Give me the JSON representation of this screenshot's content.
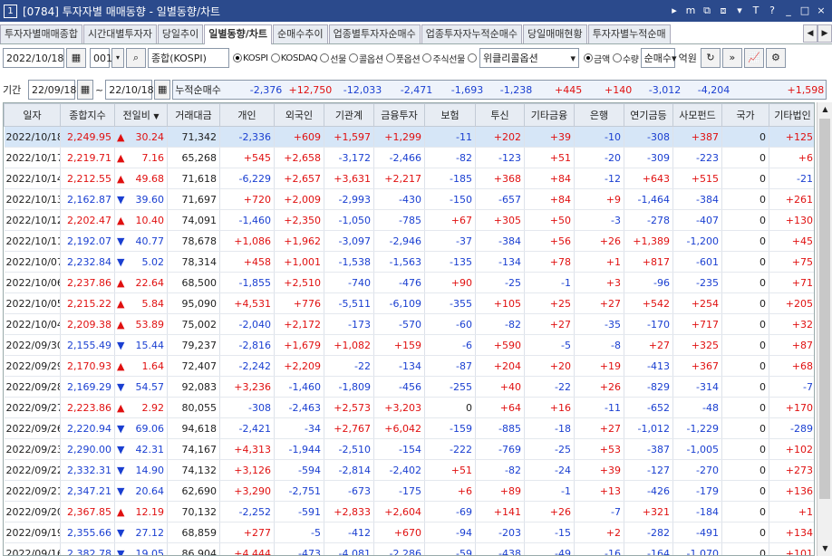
{
  "window": {
    "number": "1",
    "title": "[0784] 투자자별 매매동향 - 일별동향/차트",
    "controls": [
      "▸",
      "m",
      "⧉",
      "⧈",
      "▾",
      "T",
      "?",
      "_",
      "□",
      "×"
    ]
  },
  "tabs": [
    "투자자별매매종합",
    "시간대별투자자",
    "당일추이",
    "일별동향/차트",
    "순매수추이",
    "업종별투자자순매수",
    "업종투자자누적순매수",
    "당일매매현황",
    "투자자별누적순매"
  ],
  "active_tab": 3,
  "toolbar": {
    "date": "2022/10/18",
    "market_code": "001",
    "market_name": "종합(KOSPI)",
    "markets": [
      {
        "label": "KOSPI",
        "on": true
      },
      {
        "label": "KOSDAQ",
        "on": false
      },
      {
        "label": "선물",
        "on": false
      },
      {
        "label": "콜옵션",
        "on": false
      },
      {
        "label": "풋옵션",
        "on": false
      },
      {
        "label": "주식선물",
        "on": false
      },
      {
        "label": "",
        "on": false
      }
    ],
    "weekly_option": "위클리콜옵션",
    "unit_options": [
      {
        "label": "금액",
        "on": true
      },
      {
        "label": "수량",
        "on": false
      }
    ],
    "trade_type": "순매수",
    "unit": "억원"
  },
  "period": {
    "label": "기간",
    "from": "22/09/18",
    "to": "22/10/18",
    "cum_label": "누적순매수",
    "cum_values": [
      {
        "v": "-2,376",
        "c": "blue"
      },
      {
        "v": "+12,750",
        "c": "red"
      },
      {
        "v": "-12,033",
        "c": "blue"
      },
      {
        "v": "-2,471",
        "c": "blue"
      },
      {
        "v": "-1,693",
        "c": "blue"
      },
      {
        "v": "-1,238",
        "c": "blue"
      },
      {
        "v": "+445",
        "c": "red"
      },
      {
        "v": "+140",
        "c": "red"
      },
      {
        "v": "-3,012",
        "c": "blue"
      },
      {
        "v": "-4,204",
        "c": "blue"
      },
      {
        "v": "",
        "c": "black"
      },
      {
        "v": "+1,598",
        "c": "red"
      }
    ]
  },
  "columns": [
    "일자",
    "종합지수",
    "전일비",
    "거래대금",
    "개인",
    "외국인",
    "기관계",
    "금융투자",
    "보험",
    "투신",
    "기타금융",
    "은행",
    "연기금등",
    "사모펀드",
    "국가",
    "기타법인"
  ],
  "rows": [
    [
      "2022/10/18",
      "2,249.95",
      "up",
      "30.24",
      "71,342",
      "-2,336",
      "+609",
      "+1,597",
      "+1,299",
      "-11",
      "+202",
      "+39",
      "-10",
      "-308",
      "+387",
      "0",
      "+125"
    ],
    [
      "2022/10/17",
      "2,219.71",
      "up",
      "7.16",
      "65,268",
      "+545",
      "+2,658",
      "-3,172",
      "-2,466",
      "-82",
      "-123",
      "+51",
      "-20",
      "-309",
      "-223",
      "0",
      "+6"
    ],
    [
      "2022/10/14",
      "2,212.55",
      "up",
      "49.68",
      "71,618",
      "-6,229",
      "+2,657",
      "+3,631",
      "+2,217",
      "-185",
      "+368",
      "+84",
      "-12",
      "+643",
      "+515",
      "0",
      "-21"
    ],
    [
      "2022/10/13",
      "2,162.87",
      "dn",
      "39.60",
      "71,697",
      "+720",
      "+2,009",
      "-2,993",
      "-430",
      "-150",
      "-657",
      "+84",
      "+9",
      "-1,464",
      "-384",
      "0",
      "+261"
    ],
    [
      "2022/10/12",
      "2,202.47",
      "up",
      "10.40",
      "74,091",
      "-1,460",
      "+2,350",
      "-1,050",
      "-785",
      "+67",
      "+305",
      "+50",
      "-3",
      "-278",
      "-407",
      "0",
      "+130"
    ],
    [
      "2022/10/11",
      "2,192.07",
      "dn",
      "40.77",
      "78,678",
      "+1,086",
      "+1,962",
      "-3,097",
      "-2,946",
      "-37",
      "-384",
      "+56",
      "+26",
      "+1,389",
      "-1,200",
      "0",
      "+45"
    ],
    [
      "2022/10/07",
      "2,232.84",
      "dn",
      "5.02",
      "78,314",
      "+458",
      "+1,001",
      "-1,538",
      "-1,563",
      "-135",
      "-134",
      "+78",
      "+1",
      "+817",
      "-601",
      "0",
      "+75"
    ],
    [
      "2022/10/06",
      "2,237.86",
      "up",
      "22.64",
      "68,500",
      "-1,855",
      "+2,510",
      "-740",
      "-476",
      "+90",
      "-25",
      "-1",
      "+3",
      "-96",
      "-235",
      "0",
      "+71"
    ],
    [
      "2022/10/05",
      "2,215.22",
      "up",
      "5.84",
      "95,090",
      "+4,531",
      "+776",
      "-5,511",
      "-6,109",
      "-355",
      "+105",
      "+25",
      "+27",
      "+542",
      "+254",
      "0",
      "+205"
    ],
    [
      "2022/10/04",
      "2,209.38",
      "up",
      "53.89",
      "75,002",
      "-2,040",
      "+2,172",
      "-173",
      "-570",
      "-60",
      "-82",
      "+27",
      "-35",
      "-170",
      "+717",
      "0",
      "+32"
    ],
    [
      "2022/09/30",
      "2,155.49",
      "dn",
      "15.44",
      "79,237",
      "-2,816",
      "+1,679",
      "+1,082",
      "+159",
      "-6",
      "+590",
      "-5",
      "-8",
      "+27",
      "+325",
      "0",
      "+87"
    ],
    [
      "2022/09/29",
      "2,170.93",
      "up",
      "1.64",
      "72,407",
      "-2,242",
      "+2,209",
      "-22",
      "-134",
      "-87",
      "+204",
      "+20",
      "+19",
      "-413",
      "+367",
      "0",
      "+68"
    ],
    [
      "2022/09/28",
      "2,169.29",
      "dn",
      "54.57",
      "92,083",
      "+3,236",
      "-1,460",
      "-1,809",
      "-456",
      "-255",
      "+40",
      "-22",
      "+26",
      "-829",
      "-314",
      "0",
      "-7"
    ],
    [
      "2022/09/27",
      "2,223.86",
      "up",
      "2.92",
      "80,055",
      "-308",
      "-2,463",
      "+2,573",
      "+3,203",
      "0",
      "+64",
      "+16",
      "-11",
      "-652",
      "-48",
      "0",
      "+170"
    ],
    [
      "2022/09/26",
      "2,220.94",
      "dn",
      "69.06",
      "94,618",
      "-2,421",
      "-34",
      "+2,767",
      "+6,042",
      "-159",
      "-885",
      "-18",
      "+27",
      "-1,012",
      "-1,229",
      "0",
      "-289"
    ],
    [
      "2022/09/23",
      "2,290.00",
      "dn",
      "42.31",
      "74,167",
      "+4,313",
      "-1,944",
      "-2,510",
      "-154",
      "-222",
      "-769",
      "-25",
      "+53",
      "-387",
      "-1,005",
      "0",
      "+102"
    ],
    [
      "2022/09/22",
      "2,332.31",
      "dn",
      "14.90",
      "74,132",
      "+3,126",
      "-594",
      "-2,814",
      "-2,402",
      "+51",
      "-82",
      "-24",
      "+39",
      "-127",
      "-270",
      "0",
      "+273"
    ],
    [
      "2022/09/21",
      "2,347.21",
      "dn",
      "20.64",
      "62,690",
      "+3,290",
      "-2,751",
      "-673",
      "-175",
      "+6",
      "+89",
      "-1",
      "+13",
      "-426",
      "-179",
      "0",
      "+136"
    ],
    [
      "2022/09/20",
      "2,367.85",
      "up",
      "12.19",
      "70,132",
      "-2,252",
      "-591",
      "+2,833",
      "+2,604",
      "-69",
      "+141",
      "+26",
      "-7",
      "+321",
      "-184",
      "0",
      "+1"
    ],
    [
      "2022/09/19",
      "2,355.66",
      "dn",
      "27.12",
      "68,859",
      "+277",
      "-5",
      "-412",
      "+670",
      "-94",
      "-203",
      "-15",
      "+2",
      "-282",
      "-491",
      "0",
      "+134"
    ],
    [
      "2022/09/16",
      "2,382.78",
      "dn",
      "19.05",
      "86,904",
      "+4,444",
      "-473",
      "-4,081",
      "-2,286",
      "-59",
      "-438",
      "-49",
      "-16",
      "-164",
      "-1,070",
      "0",
      "+101"
    ]
  ],
  "colors": {
    "up": "#e01010",
    "down": "#1a3fd1",
    "title_bar": "#2b4a8c",
    "header_bg": "#e7ecf3",
    "selected_row": "#d6e6f7"
  }
}
